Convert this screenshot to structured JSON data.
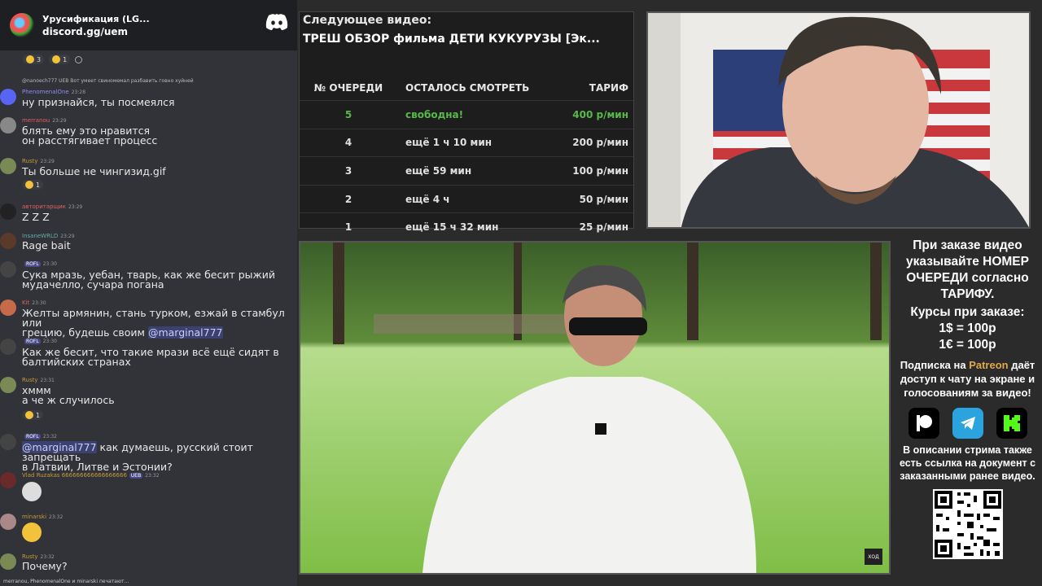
{
  "chat": {
    "server_name": "Урусификация (LG...",
    "invite_link": "discord.gg/uem",
    "top_reactions": [
      {
        "count": "3"
      },
      {
        "count": "1"
      }
    ],
    "messages": [
      {
        "reply": "@nanoech777 UEB Вот умеет свиномемал разбавить говно хуйней",
        "user": "PhenomenalOne",
        "time": "23:28",
        "lines": [
          "ну признайся, ты посмеялся"
        ]
      },
      {
        "user": "merranou",
        "time": "23:29",
        "lines": [
          "блять ему это нравится",
          "он расстягивает процесс"
        ]
      },
      {
        "user": "Rusty",
        "time": "23:29",
        "lines": [
          "Ты больше не чингизид.gif"
        ],
        "reaction_count": "1"
      },
      {
        "user": "авторитарщик",
        "time": "23:29",
        "lines": [
          "Z Z Z"
        ]
      },
      {
        "user": "InsaneWRLD",
        "time": "23:29",
        "lines": [
          "Rage bait"
        ]
      },
      {
        "user": "",
        "badge": "ROFL",
        "time": "23:30",
        "lines": [
          "Сука мразь, уебан, тварь, как же бесит рыжий",
          "мудачелло, сучара погана"
        ]
      },
      {
        "user": "Kit",
        "time": "23:30",
        "lines": [
          "Желты армянин, стань турком, езжай в стамбул или",
          "грецию, будешь своим"
        ],
        "mention": "@marginal777"
      },
      {
        "user": "",
        "badge": "ROFL",
        "time": "23:30",
        "lines": [
          "Как же бесит, что такие мрази всё ещё сидят в",
          "балтийских странах"
        ]
      },
      {
        "user": "Rusty",
        "time": "23:31",
        "lines": [
          "хммм",
          "а че ж случилось"
        ],
        "reaction_count": "1"
      },
      {
        "user": "",
        "badge": "ROFL",
        "time": "23:32",
        "mention": "@marginal777",
        "lines": [
          " как думаешь, русский стоит запрещать",
          "в Латвии, Литве и Эстонии?"
        ]
      },
      {
        "user": "Vlad Ruzakas 666666666666666666",
        "badge": "UEB",
        "time": "23:32",
        "lines": []
      },
      {
        "user": "minarski",
        "time": "23:32",
        "lines": []
      },
      {
        "user": "Rusty",
        "time": "23:32",
        "lines": [
          "Почему?"
        ]
      }
    ],
    "typing": "merranou, PhenomenalOne и minarski печатают..."
  },
  "queue": {
    "label": "Следующее видео:",
    "title": "ТРЕШ ОБЗОР фильма ДЕТИ КУКУРУЗЫ [Эк...",
    "headers": [
      "№ ОЧЕРЕДИ",
      "ОСТАЛОСЬ СМОТРЕТЬ",
      "ТАРИФ"
    ],
    "rows": [
      {
        "num": "5",
        "remaining": "свободна!",
        "rate": "400 р/мин"
      },
      {
        "num": "4",
        "remaining": "ещё 1 ч 10 мин",
        "rate": "200 р/мин"
      },
      {
        "num": "3",
        "remaining": "ещё 59 мин",
        "rate": "100 р/мин"
      },
      {
        "num": "2",
        "remaining": "ещё 4 ч",
        "rate": "50 р/мин"
      },
      {
        "num": "1",
        "remaining": "ещё 15 ч 32 мин",
        "rate": "25 р/мин"
      }
    ]
  },
  "info": {
    "order_text": "При заказе видео указывайте НОМЕР ОЧЕРЕДИ согласно ТАРИФУ.",
    "rates_title": "Курсы при заказе:",
    "rate_usd": "1$ = 100р",
    "rate_eur": "1€ = 100р",
    "patreon_prefix": "Подписка на ",
    "patreon_word": "Patreon",
    "patreon_suffix": " даёт доступ к чату на экране и голосованиям за видео!",
    "desc_text": "В описании стрима также есть ссылка на документ с заказанными ранее видео."
  },
  "video": {
    "watermark": "ХОД"
  },
  "colors": {
    "free_slot": "#59b84a",
    "patreon": "#e0a94a",
    "telegram": "#2aa3de",
    "kick": "#53fc18"
  }
}
